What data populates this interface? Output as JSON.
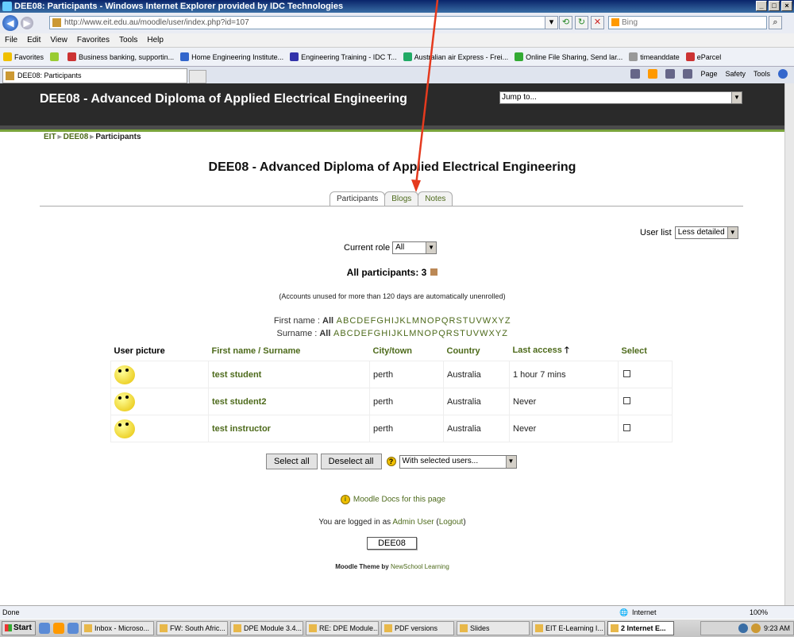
{
  "window": {
    "title": "DEE08: Participants - Windows Internet Explorer provided by IDC Technologies"
  },
  "browser": {
    "url": "http://www.eit.edu.au/moodle/user/index.php?id=107",
    "search_placeholder": "Bing",
    "menu": [
      "File",
      "Edit",
      "View",
      "Favorites",
      "Tools",
      "Help"
    ],
    "favorites_label": "Favorites",
    "favorites": [
      "Business banking, supportin...",
      "Home Engineering Institute...",
      "Engineering Training - IDC T...",
      "Australian air Express - Frei...",
      "Online File Sharing, Send lar...",
      "timeanddate",
      "eParcel"
    ],
    "tab_title": "DEE08: Participants",
    "commands": [
      "Page",
      "Safety",
      "Tools"
    ]
  },
  "site": {
    "course_title": "DEE08 - Advanced Diploma of Applied Electrical Engineering",
    "jump_to": "Jump to...",
    "breadcrumb": [
      "EIT",
      "DEE08",
      "Participants"
    ],
    "tabs": [
      "Participants",
      "Blogs",
      "Notes"
    ],
    "user_list_label": "User list",
    "user_list_value": "Less detailed",
    "current_role_label": "Current role",
    "current_role_value": "All",
    "all_participants": "All participants: 3",
    "unused_note": "(Accounts unused for more than 120 days are automatically unenrolled)",
    "first_name_label": "First name :",
    "surname_label": "Surname :",
    "alpha_all": "All",
    "letters": [
      "A",
      "B",
      "C",
      "D",
      "E",
      "F",
      "G",
      "H",
      "I",
      "J",
      "K",
      "L",
      "M",
      "N",
      "O",
      "P",
      "Q",
      "R",
      "S",
      "T",
      "U",
      "V",
      "W",
      "X",
      "Y",
      "Z"
    ]
  },
  "table": {
    "headers": [
      "User picture",
      "First name / Surname",
      "City/town",
      "Country",
      "Last access",
      "Select"
    ],
    "rows": [
      {
        "name": "test student",
        "city": "perth",
        "country": "Australia",
        "last_access": "1 hour 7 mins"
      },
      {
        "name": "test student2",
        "city": "perth",
        "country": "Australia",
        "last_access": "Never"
      },
      {
        "name": "test instructor",
        "city": "perth",
        "country": "Australia",
        "last_access": "Never"
      }
    ]
  },
  "actions": {
    "select_all": "Select all",
    "deselect_all": "Deselect all",
    "with_selected": "With selected users..."
  },
  "footer": {
    "docs_link": "Moodle Docs for this page",
    "logged_in_prefix": "You are logged in as",
    "user": "Admin User",
    "logout": "Logout",
    "course_button": "DEE08",
    "theme_prefix": "Moodle Theme by",
    "theme_author": "NewSchool Learning"
  },
  "status": {
    "text": "Done",
    "zone": "Internet",
    "zoom": "100%"
  },
  "taskbar": {
    "start": "Start",
    "tasks": [
      "Inbox - Microso...",
      "FW: South Afric...",
      "DPE Module 3.4...",
      "RE: DPE Module...",
      "PDF versions",
      "Slides",
      "EIT E-Learning I...",
      "2 Internet E..."
    ],
    "clock": "9:23 AM"
  },
  "colors": {
    "link_green": "#4d6a1b",
    "header_dark": "#2a2a2a",
    "annotation_arrow": "#e53a1e"
  }
}
